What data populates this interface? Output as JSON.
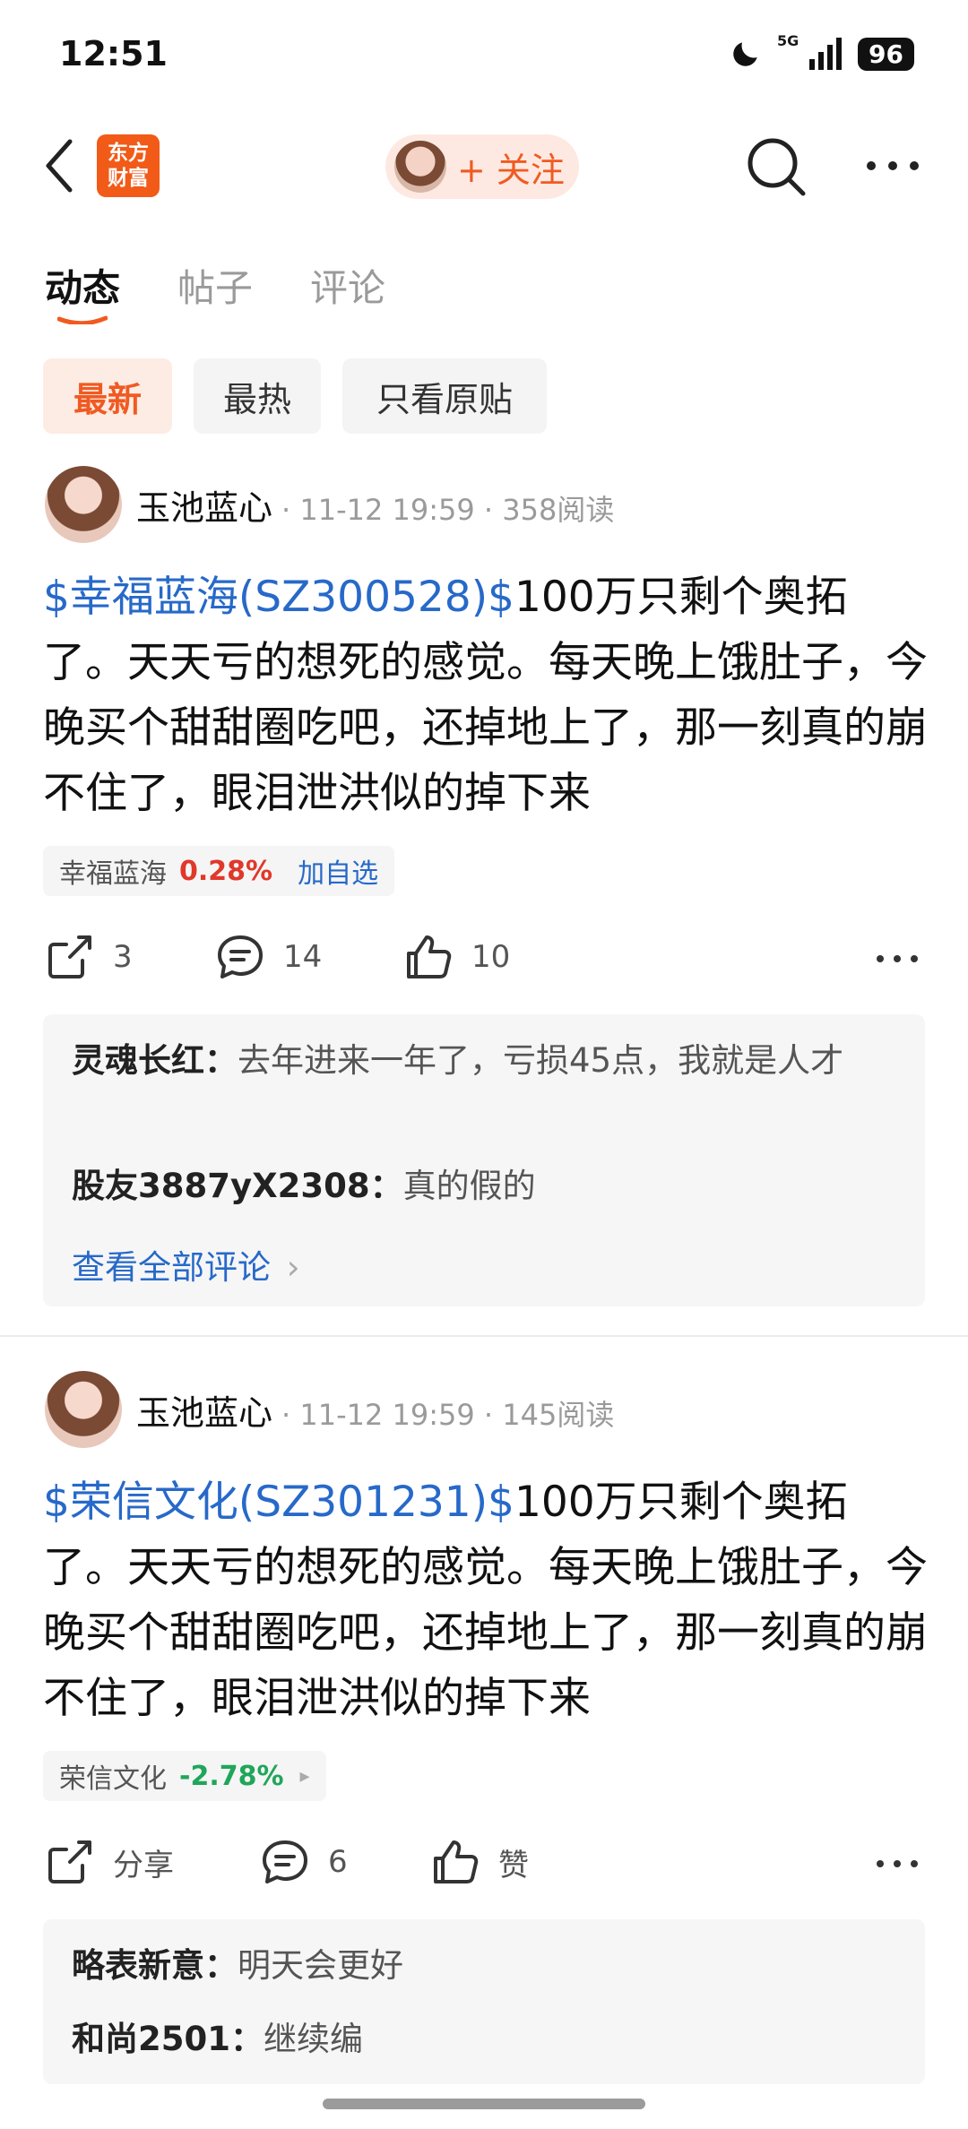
{
  "status_bar": {
    "time": "12:51",
    "network": "5G",
    "battery": "96"
  },
  "header": {
    "logo_line1": "东方",
    "logo_line2": "财富",
    "follow_label": "+ 关注"
  },
  "tabs": [
    {
      "label": "动态",
      "active": true
    },
    {
      "label": "帖子",
      "active": false
    },
    {
      "label": "评论",
      "active": false
    }
  ],
  "filters": [
    {
      "label": "最新",
      "active": true
    },
    {
      "label": "最热",
      "active": false
    },
    {
      "label": "只看原贴",
      "active": false
    }
  ],
  "posts": [
    {
      "author": "玉池蓝心",
      "meta": "· 11-12 19:59 · 358阅读",
      "stock_tag": "$幸福蓝海(SZ300528)$",
      "body": "100万只剩个奥拓了。天天亏的想死的感觉。每天晚上饿肚子，今晚买个甜甜圈吃吧，还掉地上了，那一刻真的崩不住了，眼泪泄洪似的掉下来",
      "stock_name": "幸福蓝海",
      "stock_change": "0.28%",
      "add_label": "加自选",
      "share": "3",
      "comments": "14",
      "likes": "10",
      "replies": [
        {
          "user": "灵魂长红：",
          "text": "去年进来一年了，亏损45点，我就是人才"
        },
        {
          "user": "股友3887yX2308：",
          "text": "真的假的"
        }
      ],
      "view_all": "查看全部评论",
      "view_all_chevron": "›"
    },
    {
      "author": "玉池蓝心",
      "meta": "· 11-12 19:59 · 145阅读",
      "stock_tag": "$荣信文化(SZ301231)$",
      "body": "100万只剩个奥拓了。天天亏的想死的感觉。每天晚上饿肚子，今晚买个甜甜圈吃吧，还掉地上了，那一刻真的崩不住了，眼泪泄洪似的掉下来",
      "stock_name": "荣信文化",
      "stock_change": "-2.78%",
      "stock_arrow": "▸",
      "share": "分享",
      "comments": "6",
      "likes": "赞",
      "replies": [
        {
          "user": "略表新意：",
          "text": "明天会更好"
        },
        {
          "user": "和尚2501：",
          "text": "继续编"
        }
      ]
    }
  ],
  "colors": {
    "accent": "#f05a22",
    "link": "#2769c9",
    "up": "#e0382a",
    "down": "#1fa65a"
  }
}
